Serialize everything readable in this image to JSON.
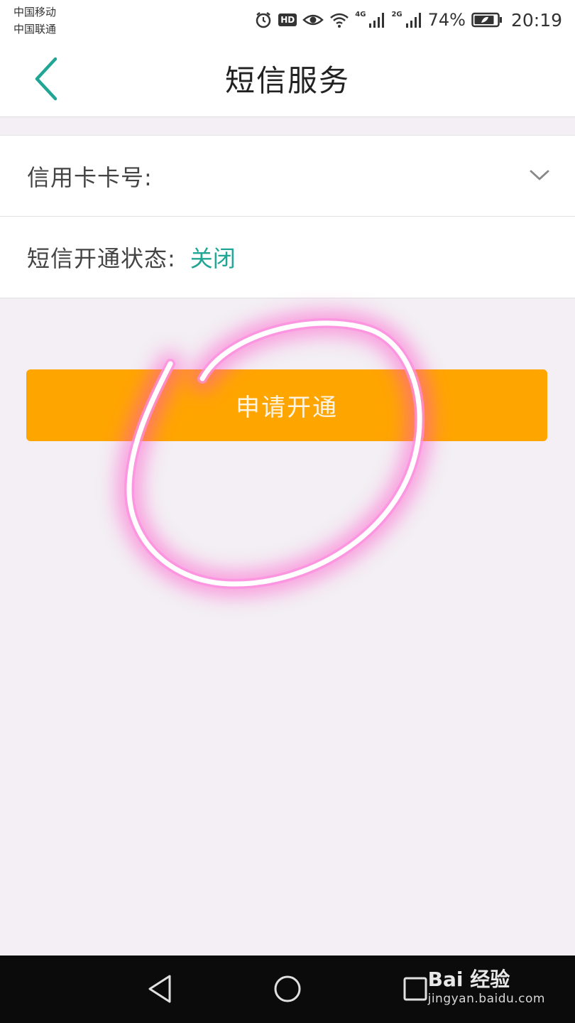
{
  "status_bar": {
    "carrier_1": "中国移动",
    "carrier_2": "中国联通",
    "hd_badge": "HD",
    "net_1": "4G",
    "net_2": "2G",
    "battery": "74%",
    "time": "20:19",
    "icons": [
      "alarm-icon",
      "hd-icon",
      "eye-icon",
      "wifi-icon",
      "signal-icon",
      "signal-icon",
      "battery-icon"
    ]
  },
  "header": {
    "title": "短信服务",
    "back_icon": "chevron-left-icon"
  },
  "form": {
    "card_number_label": "信用卡卡号:",
    "card_number_dropdown_icon": "chevron-down-icon",
    "sms_status_label": "短信开通状态:",
    "sms_status_value": "关闭"
  },
  "actions": {
    "apply_label": "申请开通"
  },
  "system_nav": {
    "icons": [
      "back-triangle-icon",
      "home-circle-icon",
      "recents-square-icon"
    ]
  },
  "watermark": {
    "main": "Bai 经验",
    "sub": "jingyan.baidu.com"
  },
  "colors": {
    "accent_teal": "#21a594",
    "button_orange": "#ffa500",
    "annotation_pink": "#ff6ad5",
    "page_bg": "#f3eff4"
  }
}
